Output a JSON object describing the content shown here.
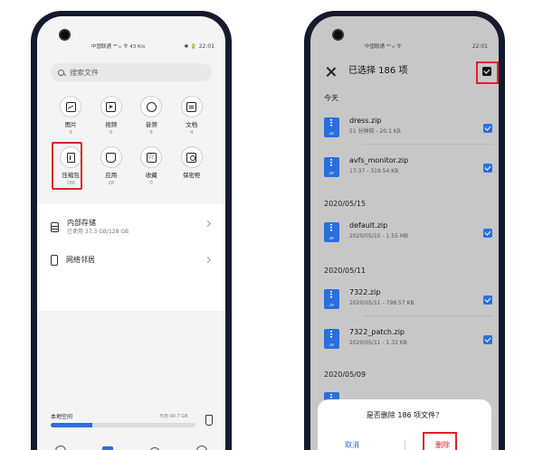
{
  "left": {
    "status": {
      "carrier": "中国联通 ⁴ᴳ ᵢₗₗ 令",
      "speed": "43 K/s",
      "time": "22:01",
      "icons": "✱ 🔋"
    },
    "search": {
      "placeholder": "搜索文件"
    },
    "categories": [
      {
        "name": "图片",
        "count": "9",
        "icon": "image-icon"
      },
      {
        "name": "视频",
        "count": "0",
        "icon": "video-icon"
      },
      {
        "name": "音频",
        "count": "6",
        "icon": "music-icon"
      },
      {
        "name": "文档",
        "count": "4",
        "icon": "document-icon"
      },
      {
        "name": "压缩包",
        "count": "186",
        "icon": "archive-icon"
      },
      {
        "name": "应用",
        "count": "28",
        "icon": "app-icon"
      },
      {
        "name": "收藏",
        "count": "0",
        "icon": "star-icon"
      },
      {
        "name": "保密柜",
        "count": "",
        "icon": "safe-icon"
      }
    ],
    "storage": {
      "internal_title": "内部存储",
      "internal_sub": "已使用 37.3 GB/128 GB",
      "network_title": "网络邻居"
    },
    "local": {
      "label": "本地空间",
      "free": "可用 90.7 GB",
      "used_fraction": 0.29
    }
  },
  "right": {
    "status": {
      "carrier": "中国联通 ⁴ᴳ ᵢₗₗ 令",
      "time": "22:01"
    },
    "title": "已选择 186 项",
    "groups": [
      {
        "label": "今天",
        "files": [
          {
            "name": "dress.zip",
            "meta": "51 分钟前 - 20.1 KB"
          },
          {
            "name": "avfs_monitor.zip",
            "meta": "17:37 - 319.54 KB"
          }
        ]
      },
      {
        "label": "2020/05/15",
        "files": [
          {
            "name": "default.zip",
            "meta": "2020/05/15 - 1.55 MB"
          }
        ]
      },
      {
        "label": "2020/05/11",
        "files": [
          {
            "name": "7322.zip",
            "meta": "2020/05/11 - 798.57 KB"
          },
          {
            "name": "7322_patch.zip",
            "meta": "2020/05/11 - 1.32 KB"
          }
        ]
      },
      {
        "label": "2020/05/09",
        "files": []
      }
    ],
    "dialog": {
      "question": "是否删除 186 项文件？",
      "cancel": "取消",
      "delete": "删除"
    }
  },
  "colors": {
    "accent": "#2a6fe0",
    "highlight": "#e0202c"
  }
}
